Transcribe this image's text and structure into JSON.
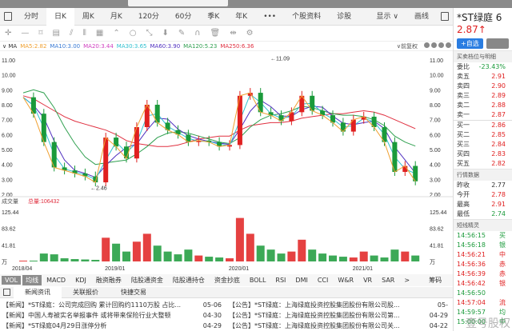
{
  "tabs": [
    "分时",
    "日K",
    "周K",
    "月K",
    "120分",
    "60分",
    "季K",
    "年K",
    "•••",
    "个股资料",
    "诊股"
  ],
  "tabs_right": {
    "display": "显示 ∨",
    "draw": "画线"
  },
  "toolbar_icons": [
    "crosshair-icon",
    "line-icon",
    "rect-icon",
    "fib-icon",
    "ruler-icon",
    "vlines-icon",
    "channel-icon",
    "wave-icon",
    "circle-icon",
    "pen-icon",
    "pin-icon",
    "brush-icon",
    "magnet-icon",
    "trash-icon",
    "move-icon",
    "settings-icon"
  ],
  "toolbar_glyphs": [
    "✛",
    "—",
    "⌑",
    "▤",
    "⫽",
    "⦀",
    "▦",
    "⌃",
    "○",
    "⤡",
    "⬇",
    "✎",
    "∩",
    "🗑",
    "⇹",
    "⚙"
  ],
  "ma_bar": {
    "label": "∨ MA",
    "items": [
      {
        "t": "MA5:2.82",
        "c": "#f0a030"
      },
      {
        "t": "MA10:3.00",
        "c": "#3a7bd5"
      },
      {
        "t": "MA20:3.44",
        "c": "#d040c0"
      },
      {
        "t": "MA30:3.65",
        "c": "#30c0d0"
      },
      {
        "t": "MA60:3.90",
        "c": "#5030c0"
      },
      {
        "t": "MA120:5.23",
        "c": "#30a050"
      },
      {
        "t": "MA250:6.36",
        "c": "#e03040"
      }
    ],
    "adjust": "∨前复权"
  },
  "chart_data": [
    {
      "type": "candlestick-line",
      "title": "日K",
      "x": [
        "2018/04",
        "2018/05",
        "2018/06",
        "2018/07",
        "2018/08",
        "2018/09",
        "2018/10",
        "2018/11",
        "2018/12",
        "2019/01",
        "2019/02",
        "2019/03",
        "2019/04",
        "2019/05",
        "2019/06",
        "2019/07",
        "2019/08",
        "2019/09",
        "2019/10",
        "2019/11",
        "2019/12",
        "2020/01",
        "2020/02",
        "2020/03",
        "2020/04",
        "2020/05",
        "2020/06",
        "2020/07",
        "2020/08",
        "2020/09",
        "2020/10",
        "2020/11",
        "2020/12",
        "2021/01",
        "2021/02",
        "2021/03",
        "2021/04",
        "2021/05",
        "2021/06"
      ],
      "close": [
        8.5,
        7.4,
        5.5,
        3.8,
        3.6,
        3.4,
        3.2,
        2.8,
        5.8,
        5.2,
        4.4,
        6.5,
        8.0,
        6.8,
        6.3,
        6.0,
        5.5,
        5.6,
        5.5,
        5.2,
        5.3,
        8.6,
        8.8,
        7.5,
        7.3,
        6.9,
        7.5,
        8.6,
        7.6,
        7.3,
        6.8,
        6.2,
        7.0,
        7.2,
        6.5,
        5.5,
        3.5,
        3.9,
        2.87
      ],
      "ma250": [
        8.6,
        8.4,
        8.0,
        7.6,
        7.2,
        6.9,
        6.7,
        6.5,
        6.3,
        6.0,
        5.6,
        5.4,
        5.3,
        5.2,
        5.2,
        5.3,
        5.5,
        5.7,
        5.8,
        5.9,
        5.9,
        6.3,
        6.6,
        6.7,
        6.8,
        6.8,
        6.9,
        7.1,
        7.2,
        7.3,
        7.4,
        7.4,
        7.5,
        7.6,
        7.5,
        7.3,
        7.0,
        6.7,
        6.4
      ],
      "ma120": [
        8.8,
        9.0,
        8.8,
        7.8,
        6.5,
        5.4,
        4.5,
        4.0,
        4.1,
        4.2,
        4.3,
        4.7,
        5.2,
        5.8,
        6.1,
        6.2,
        6.1,
        5.9,
        5.7,
        5.5,
        5.4,
        5.8,
        6.5,
        7.0,
        7.3,
        7.4,
        7.6,
        7.9,
        7.8,
        7.6,
        7.4,
        7.3,
        7.3,
        7.2,
        7.0,
        6.6,
        5.9,
        5.5,
        5.23
      ],
      "ymin": 2,
      "ymax": 11,
      "yticks": [
        "11.00",
        "10.00",
        "9.00",
        "8.00",
        "7.00",
        "6.00",
        "5.00",
        "4.00",
        "3.00",
        "2.00"
      ],
      "annotations": {
        "high": "←11.09",
        "low": "←2.46"
      },
      "xticks": [
        "2018/04",
        "2019/01",
        "2020/01",
        "2021/01"
      ]
    },
    {
      "type": "bar",
      "title": "成交量",
      "total": "总量:106432",
      "volume": [
        2,
        2,
        20,
        18,
        8,
        6,
        5,
        4,
        60,
        45,
        25,
        50,
        70,
        40,
        25,
        18,
        30,
        15,
        12,
        10,
        8,
        110,
        70,
        40,
        30,
        20,
        25,
        55,
        30,
        20,
        15,
        12,
        10,
        25,
        15,
        10,
        30,
        25,
        15
      ],
      "ymax": 125.44,
      "yticks": [
        "125.44",
        "83.62",
        "41.81",
        "万"
      ]
    }
  ],
  "indicators": {
    "on": [
      "VOL",
      "均线"
    ],
    "items": [
      "MACD",
      "KDJ",
      "融资融券",
      "陆股通资金",
      "陆股通持仓",
      "资金抄底",
      "BOLL",
      "RSI",
      "DMI",
      "CCI",
      "W&R",
      "VR",
      "SAR",
      ">"
    ],
    "chip": "筹码"
  },
  "news_tabs": [
    "新闻资讯",
    "关联报价",
    "快捷交易"
  ],
  "news": [
    [
      {
        "t": "【新闻】*ST绿庭：公司完成回购 累计回购约1110万股 占比...",
        "d": "05-06"
      },
      {
        "t": "【公告】*ST绿庭：上海绿庭投资控股集团股份有限公司股...",
        "d": "05-"
      }
    ],
    [
      {
        "t": "【新闻】中国人寿被实名举报事件 或将带来保险行业大整顿",
        "d": "04-30"
      },
      {
        "t": "【公告】*ST绿庭：上海绿庭投资控股集团股份有限公司第...",
        "d": "04-29"
      }
    ],
    [
      {
        "t": "【新闻】*ST绿庭04月29日涨停分析",
        "d": "04-29"
      },
      {
        "t": "【公告】*ST绿庭：上海绿庭投资控股集团股份有限公司关...",
        "d": "04-22"
      }
    ]
  ],
  "side": {
    "name": "*ST绿庭 6",
    "price": "2.87↑",
    "add": "+自选",
    "book_title": "买卖档位与明细",
    "ratio_label": "委比",
    "ratio": "-23.43%",
    "sells": [
      {
        "l": "卖五",
        "v": "2.91"
      },
      {
        "l": "卖四",
        "v": "2.90"
      },
      {
        "l": "卖三",
        "v": "2.89"
      },
      {
        "l": "卖二",
        "v": "2.88"
      },
      {
        "l": "卖一",
        "v": "2.87"
      }
    ],
    "buys": [
      {
        "l": "买一",
        "v": "2.86"
      },
      {
        "l": "买二",
        "v": "2.85"
      },
      {
        "l": "买三",
        "v": "2.84"
      },
      {
        "l": "买四",
        "v": "2.83"
      },
      {
        "l": "买五",
        "v": "2.82"
      }
    ],
    "quote_title": "行情数据",
    "quotes": [
      {
        "l": "昨收",
        "v": "2.77",
        "c": ""
      },
      {
        "l": "今开",
        "v": "2.78",
        "c": "red"
      },
      {
        "l": "最高",
        "v": "2.91",
        "c": "red"
      },
      {
        "l": "最低",
        "v": "2.74",
        "c": "green"
      }
    ],
    "elf_title": "短线精灵",
    "elf": [
      {
        "t": "14:56:15",
        "s": "买",
        "c": "green"
      },
      {
        "t": "14:56:18",
        "s": "银",
        "c": "green"
      },
      {
        "t": "14:56:21",
        "s": "中",
        "c": "red"
      },
      {
        "t": "14:56:36",
        "s": "赤",
        "c": "red"
      },
      {
        "t": "14:56:39",
        "s": "赤",
        "c": "red"
      },
      {
        "t": "14:56:42",
        "s": "银",
        "c": "red"
      },
      {
        "t": "14:56:50",
        "s": "",
        "c": "green"
      },
      {
        "t": "14:57:04",
        "s": "流",
        "c": "red"
      },
      {
        "t": "14:59:57",
        "s": "均",
        "c": "green"
      },
      {
        "t": "15:00:00",
        "s": "中",
        "c": "green"
      }
    ]
  },
  "watermark": "壹号股权"
}
